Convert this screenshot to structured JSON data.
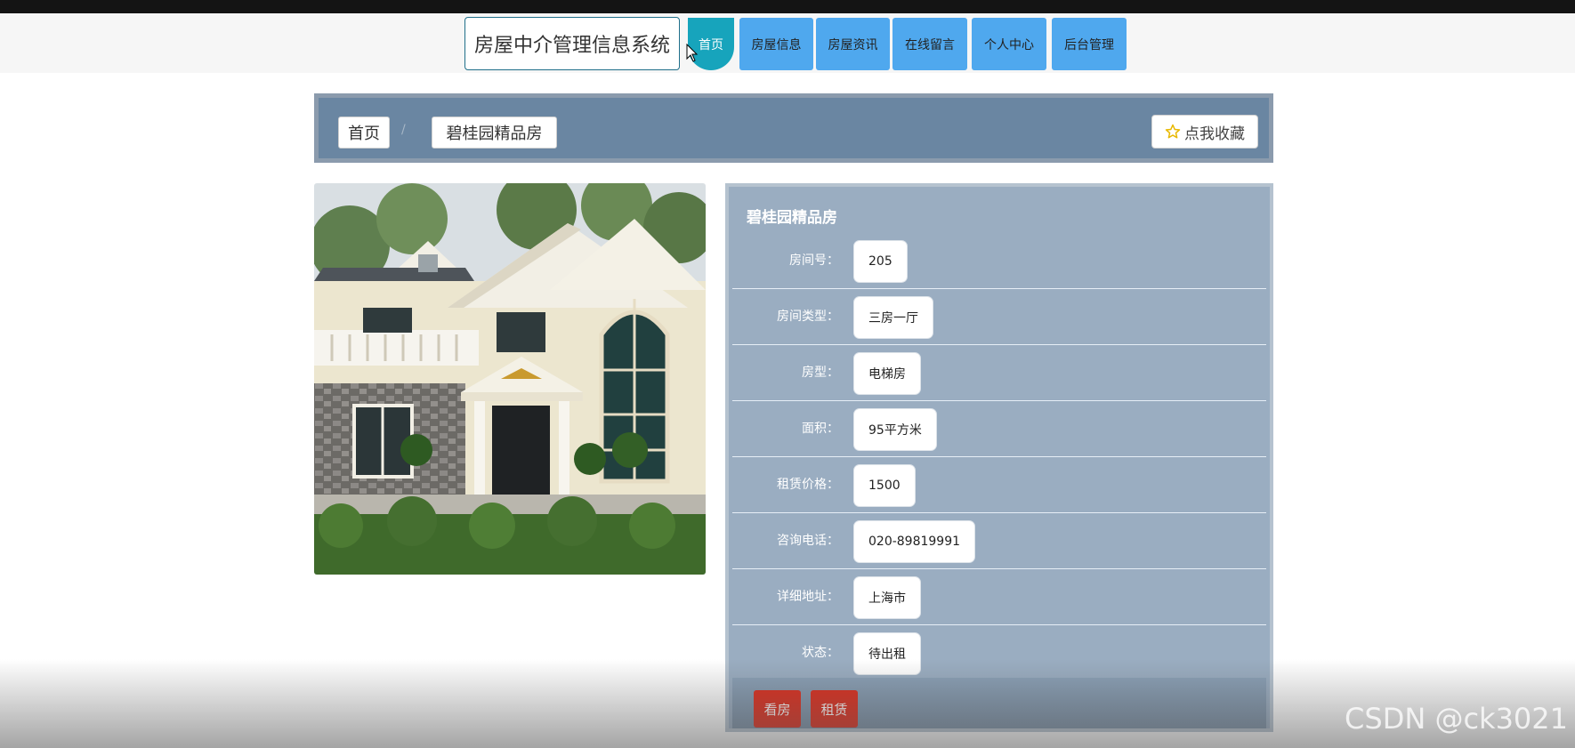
{
  "header": {
    "brand": "房屋中介管理信息系统",
    "nav": [
      {
        "label": "首页",
        "active": true
      },
      {
        "label": "房屋信息"
      },
      {
        "label": "房屋资讯"
      },
      {
        "label": "在线留言"
      },
      {
        "label": "个人中心"
      },
      {
        "label": "后台管理"
      }
    ]
  },
  "breadcrumb": {
    "items": [
      "首页",
      "碧桂园精品房"
    ],
    "separator": "/",
    "favorite_label": "点我收藏"
  },
  "detail": {
    "title": "碧桂园精品房",
    "fields": [
      {
        "label": "房间号：",
        "value": "205"
      },
      {
        "label": "房间类型：",
        "value": "三房一厅"
      },
      {
        "label": "房型：",
        "value": "电梯房"
      },
      {
        "label": "面积：",
        "value": "95平方米"
      },
      {
        "label": "租赁价格：",
        "value": "1500"
      },
      {
        "label": "咨询电话：",
        "value": "020-89819991"
      },
      {
        "label": "详细地址：",
        "value": "上海市"
      },
      {
        "label": "状态：",
        "value": "待出租"
      }
    ],
    "actions": [
      "看房",
      "租赁"
    ]
  },
  "watermark": "CSDN @ck3021",
  "colors": {
    "nav": "#4fa8ee",
    "nav_active": "#17a4bc",
    "action": "#dd2c1c",
    "panel": "#9aadc1"
  },
  "icons": {
    "favorite": "star-icon",
    "cursor": "mouse-pointer-icon"
  }
}
